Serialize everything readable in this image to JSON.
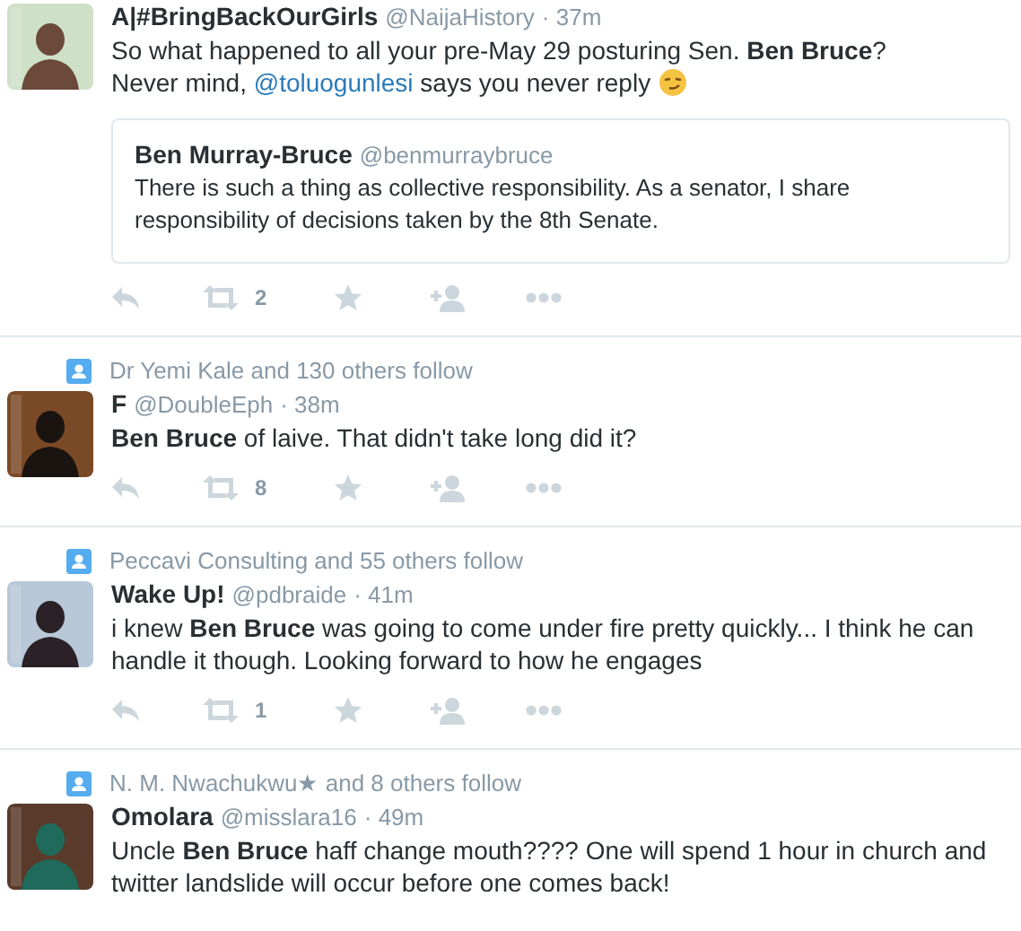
{
  "tweets": [
    {
      "name": "A|#BringBackOurGirls",
      "handle": "@NaijaHistory",
      "time": "· 37m",
      "body": [
        {
          "kind": "text",
          "text": "So what happened to all your pre-May 29 posturing Sen. **Ben Bruce**?"
        },
        {
          "kind": "break"
        },
        {
          "kind": "text",
          "text": "Never mind, "
        },
        {
          "kind": "link",
          "text": "@toluogunlesi"
        },
        {
          "kind": "text",
          "text": " says you never reply"
        },
        {
          "kind": "emoji"
        }
      ],
      "quote": {
        "name": "Ben Murray-Bruce",
        "handle": "@benmurraybruce",
        "text": "There is such a thing as collective responsibility. As a senator, I share responsibility of decisions taken by the 8th Senate."
      },
      "actions": {
        "retweets": "2"
      }
    },
    {
      "context": "Dr Yemi Kale and 130 others follow",
      "name": "F",
      "handle": "@DoubleEph",
      "time": "· 38m",
      "body": [
        {
          "kind": "text",
          "text": "**Ben Bruce** of laive. That didn't take long did it?"
        }
      ],
      "actions": {
        "retweets": "8"
      }
    },
    {
      "context": "Peccavi Consulting and 55 others follow",
      "name": "Wake Up!",
      "handle": "@pdbraide",
      "time": "· 41m",
      "body": [
        {
          "kind": "text",
          "text": "i knew **Ben Bruce** was going to come under fire pretty quickly... I think he can handle it though. Looking forward to how he engages"
        }
      ],
      "actions": {
        "retweets": "1"
      }
    },
    {
      "context": "N. M. Nwachukwu★ and 8 others follow",
      "name": "Omolara",
      "handle": "@misslara16",
      "time": "· 49m",
      "body": [
        {
          "kind": "text",
          "text": "Uncle **Ben Bruce** haff change mouth???? One will spend 1 hour in church and twitter landslide will occur before one comes back!"
        }
      ]
    }
  ]
}
